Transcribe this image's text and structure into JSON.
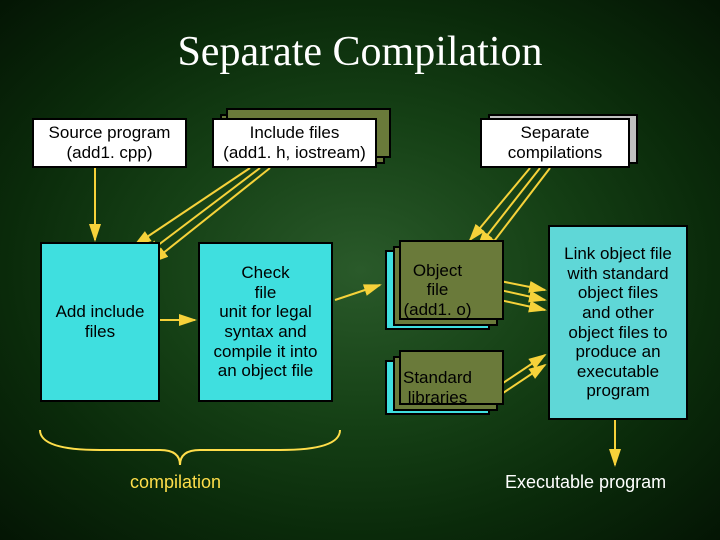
{
  "title": "Separate Compilation",
  "boxes": {
    "source_program": "Source program\n(add1. cpp)",
    "include_files": "Include files\n(add1. h, iostream)",
    "separate_compilations": "Separate\ncompilations",
    "add_include": "Add include\nfiles",
    "check_file": "Check\nfile\nunit for legal\nsyntax and\ncompile it into\nan object file",
    "object_file": "Object\nfile\n(add1. o)",
    "standard_libraries": "Standard\nlibraries",
    "link_object": "Link object file\nwith standard\nobject files\nand other\nobject files to\nproduce an\nexecutable\nprogram"
  },
  "footer": {
    "compilation": "compilation",
    "executable": "Executable program"
  },
  "colors": {
    "arrow": "#f6d23a",
    "cyan": "#3fdfdf",
    "white": "#ffffff"
  }
}
